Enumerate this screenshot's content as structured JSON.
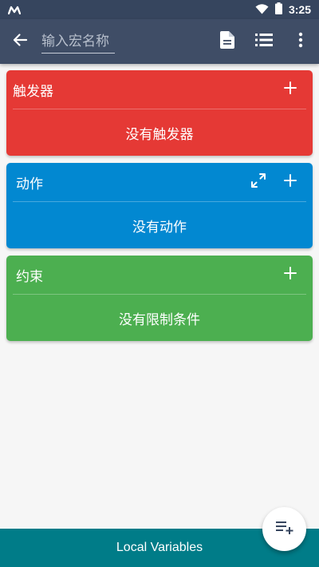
{
  "status_bar": {
    "time": "3:25",
    "app_icon": "macrodroid-logo-icon",
    "wifi_icon": "wifi-icon",
    "battery_icon": "battery-icon"
  },
  "app_bar": {
    "back_icon": "back-arrow-icon",
    "name_placeholder": "输入宏名称",
    "name_value": "",
    "actions": [
      "document-icon",
      "list-icon",
      "more-vert-icon"
    ],
    "color": "#3f4d66"
  },
  "sections": {
    "triggers": {
      "title": "触发器",
      "empty_text": "没有触发器",
      "color": "#e53935"
    },
    "actions": {
      "title": "动作",
      "empty_text": "没有动作",
      "color": "#0288d1"
    },
    "constraints": {
      "title": "约束",
      "empty_text": "没有限制条件",
      "color": "#4caf50"
    }
  },
  "bottom_bar": {
    "label": "Local Variables",
    "color": "#007c88"
  },
  "fab": {
    "icon": "playlist-add-icon"
  }
}
